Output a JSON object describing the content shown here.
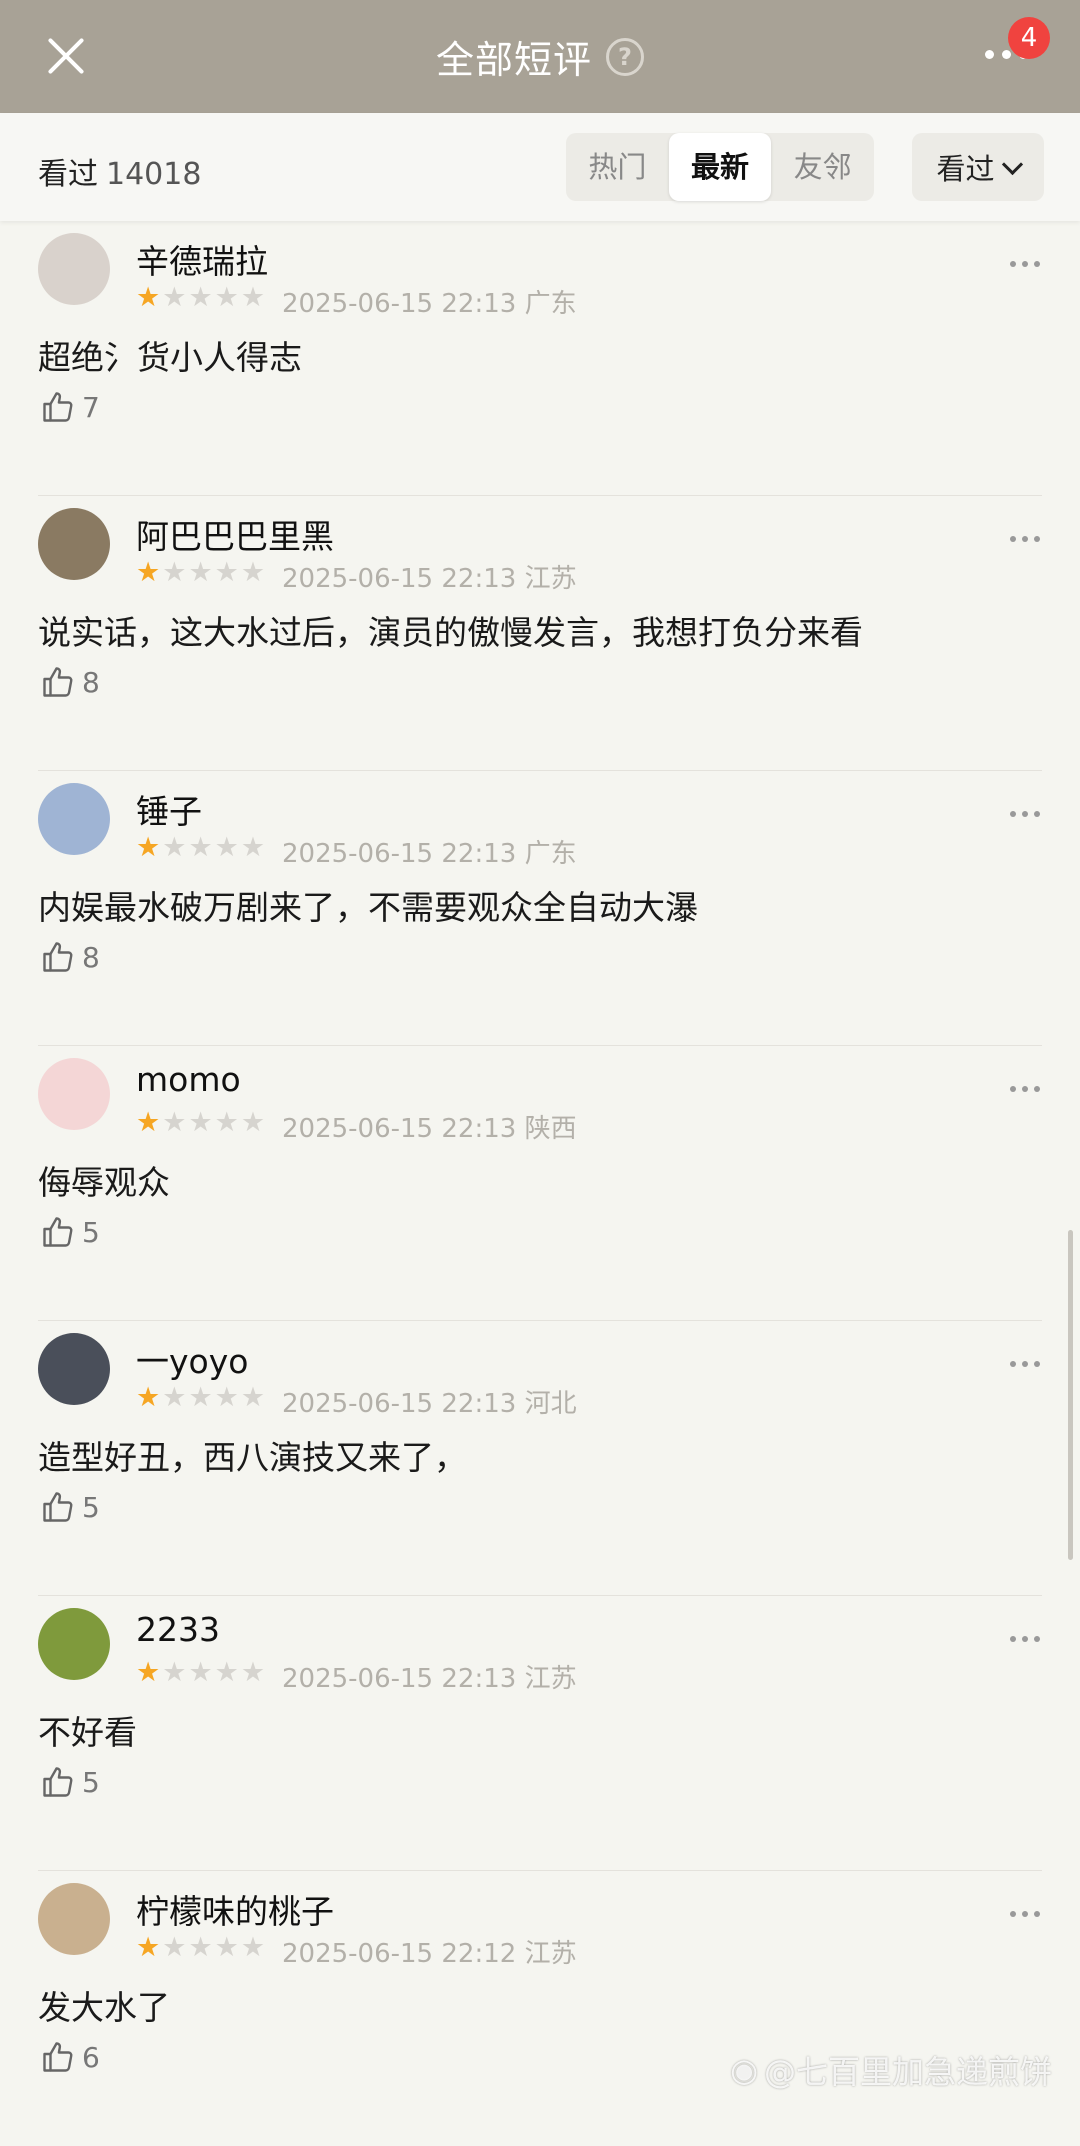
{
  "header": {
    "title": "全部短评",
    "help_glyph": "?",
    "notification_count": "4"
  },
  "filter": {
    "seen_label": "看过",
    "seen_count": "14018",
    "tabs": [
      "热门",
      "最新",
      "友邻"
    ],
    "active_tab": "最新",
    "dropdown_label": "看过"
  },
  "reviews": [
    {
      "user": "辛德瑞拉",
      "rating": 1,
      "date": "2025-06-15 22:13",
      "region": "广东",
      "text": "超绝氵货小人得志",
      "likes": "7",
      "avatar_color": "#d9d2cc"
    },
    {
      "user": "阿巴巴巴里黑",
      "rating": 1,
      "date": "2025-06-15 22:13",
      "region": "江苏",
      "text": "说实话，这大水过后，演员的傲慢发言，我想打负分来看",
      "likes": "8",
      "avatar_color": "#8a7a62"
    },
    {
      "user": "锤子",
      "rating": 1,
      "date": "2025-06-15 22:13",
      "region": "广东",
      "text": "内娱最水破万剧来了，不需要观众全自动大瀑",
      "likes": "8",
      "avatar_color": "#9fb4d4"
    },
    {
      "user": "momo",
      "rating": 1,
      "date": "2025-06-15 22:13",
      "region": "陕西",
      "text": "侮辱观众",
      "likes": "5",
      "avatar_color": "#f4d6d6"
    },
    {
      "user": "一yoyo",
      "rating": 1,
      "date": "2025-06-15 22:13",
      "region": "河北",
      "text": "造型好丑，西八演技又来了，",
      "likes": "5",
      "avatar_color": "#4a4f5a"
    },
    {
      "user": "2233",
      "rating": 1,
      "date": "2025-06-15 22:13",
      "region": "江苏",
      "text": "不好看",
      "likes": "5",
      "avatar_color": "#7f9a3c"
    },
    {
      "user": "柠檬味的桃子",
      "rating": 1,
      "date": "2025-06-15 22:12",
      "region": "江苏",
      "text": "发大水了",
      "likes": "6",
      "avatar_color": "#c9b08f"
    }
  ],
  "watermark": "@七百里加急递煎饼"
}
